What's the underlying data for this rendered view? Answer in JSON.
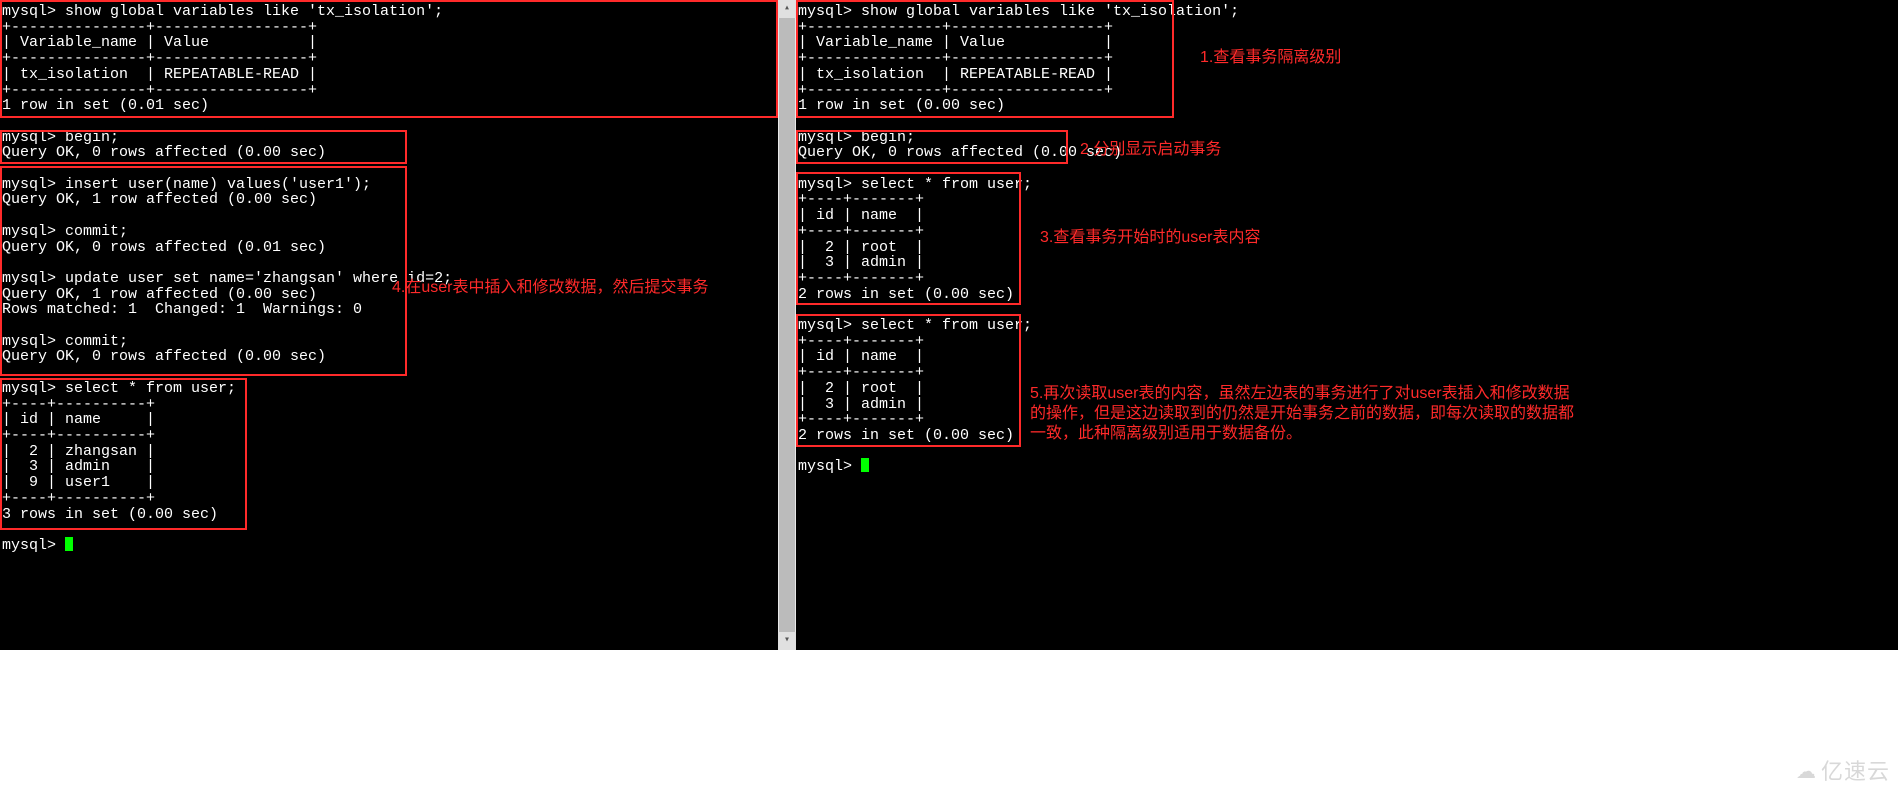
{
  "left": {
    "block1": "mysql> show global variables like 'tx_isolation';\n+---------------+-----------------+\n| Variable_name | Value           |\n+---------------+-----------------+\n| tx_isolation  | REPEATABLE-READ |\n+---------------+-----------------+\n1 row in set (0.01 sec)",
    "block2": "mysql> begin;\nQuery OK, 0 rows affected (0.00 sec)",
    "block3": "mysql> insert user(name) values('user1');\nQuery OK, 1 row affected (0.00 sec)\n\nmysql> commit;\nQuery OK, 0 rows affected (0.01 sec)\n\nmysql> update user set name='zhangsan' where id=2;\nQuery OK, 1 row affected (0.00 sec)\nRows matched: 1  Changed: 1  Warnings: 0\n\nmysql> commit;\nQuery OK, 0 rows affected (0.00 sec)",
    "block4": "mysql> select * from user;\n+----+----------+\n| id | name     |\n+----+----------+\n|  2 | zhangsan |\n|  3 | admin    |\n|  9 | user1    |\n+----+----------+\n3 rows in set (0.00 sec)",
    "prompt": "mysql> "
  },
  "right": {
    "block1": "mysql> show global variables like 'tx_isolation';\n+---------------+-----------------+\n| Variable_name | Value           |\n+---------------+-----------------+\n| tx_isolation  | REPEATABLE-READ |\n+---------------+-----------------+\n1 row in set (0.00 sec)",
    "block2": "mysql> begin;\nQuery OK, 0 rows affected (0.00 sec)",
    "block3": "mysql> select * from user;\n+----+-------+\n| id | name  |\n+----+-------+\n|  2 | root  |\n|  3 | admin |\n+----+-------+\n2 rows in set (0.00 sec)",
    "block4": "mysql> select * from user;\n+----+-------+\n| id | name  |\n+----+-------+\n|  2 | root  |\n|  3 | admin |\n+----+-------+\n2 rows in set (0.00 sec)",
    "prompt": "mysql> "
  },
  "annotations": {
    "a1": "1.查看事务隔离级别",
    "a2": "2.分别显示启动事务",
    "a3": "3.查看事务开始时的user表内容",
    "a4": "4.在user表中插入和修改数据，然后提交事务",
    "a5": "5.再次读取user表的内容，虽然左边表的事务进行了对user表插入和修改数据的操作，但是这边读取到的仍然是开始事务之前的数据，即每次读取的数据都一致，此种隔离级别适用于数据备份。"
  },
  "watermark": "亿速云",
  "scroll": {
    "up": "▴",
    "down": "▾"
  }
}
